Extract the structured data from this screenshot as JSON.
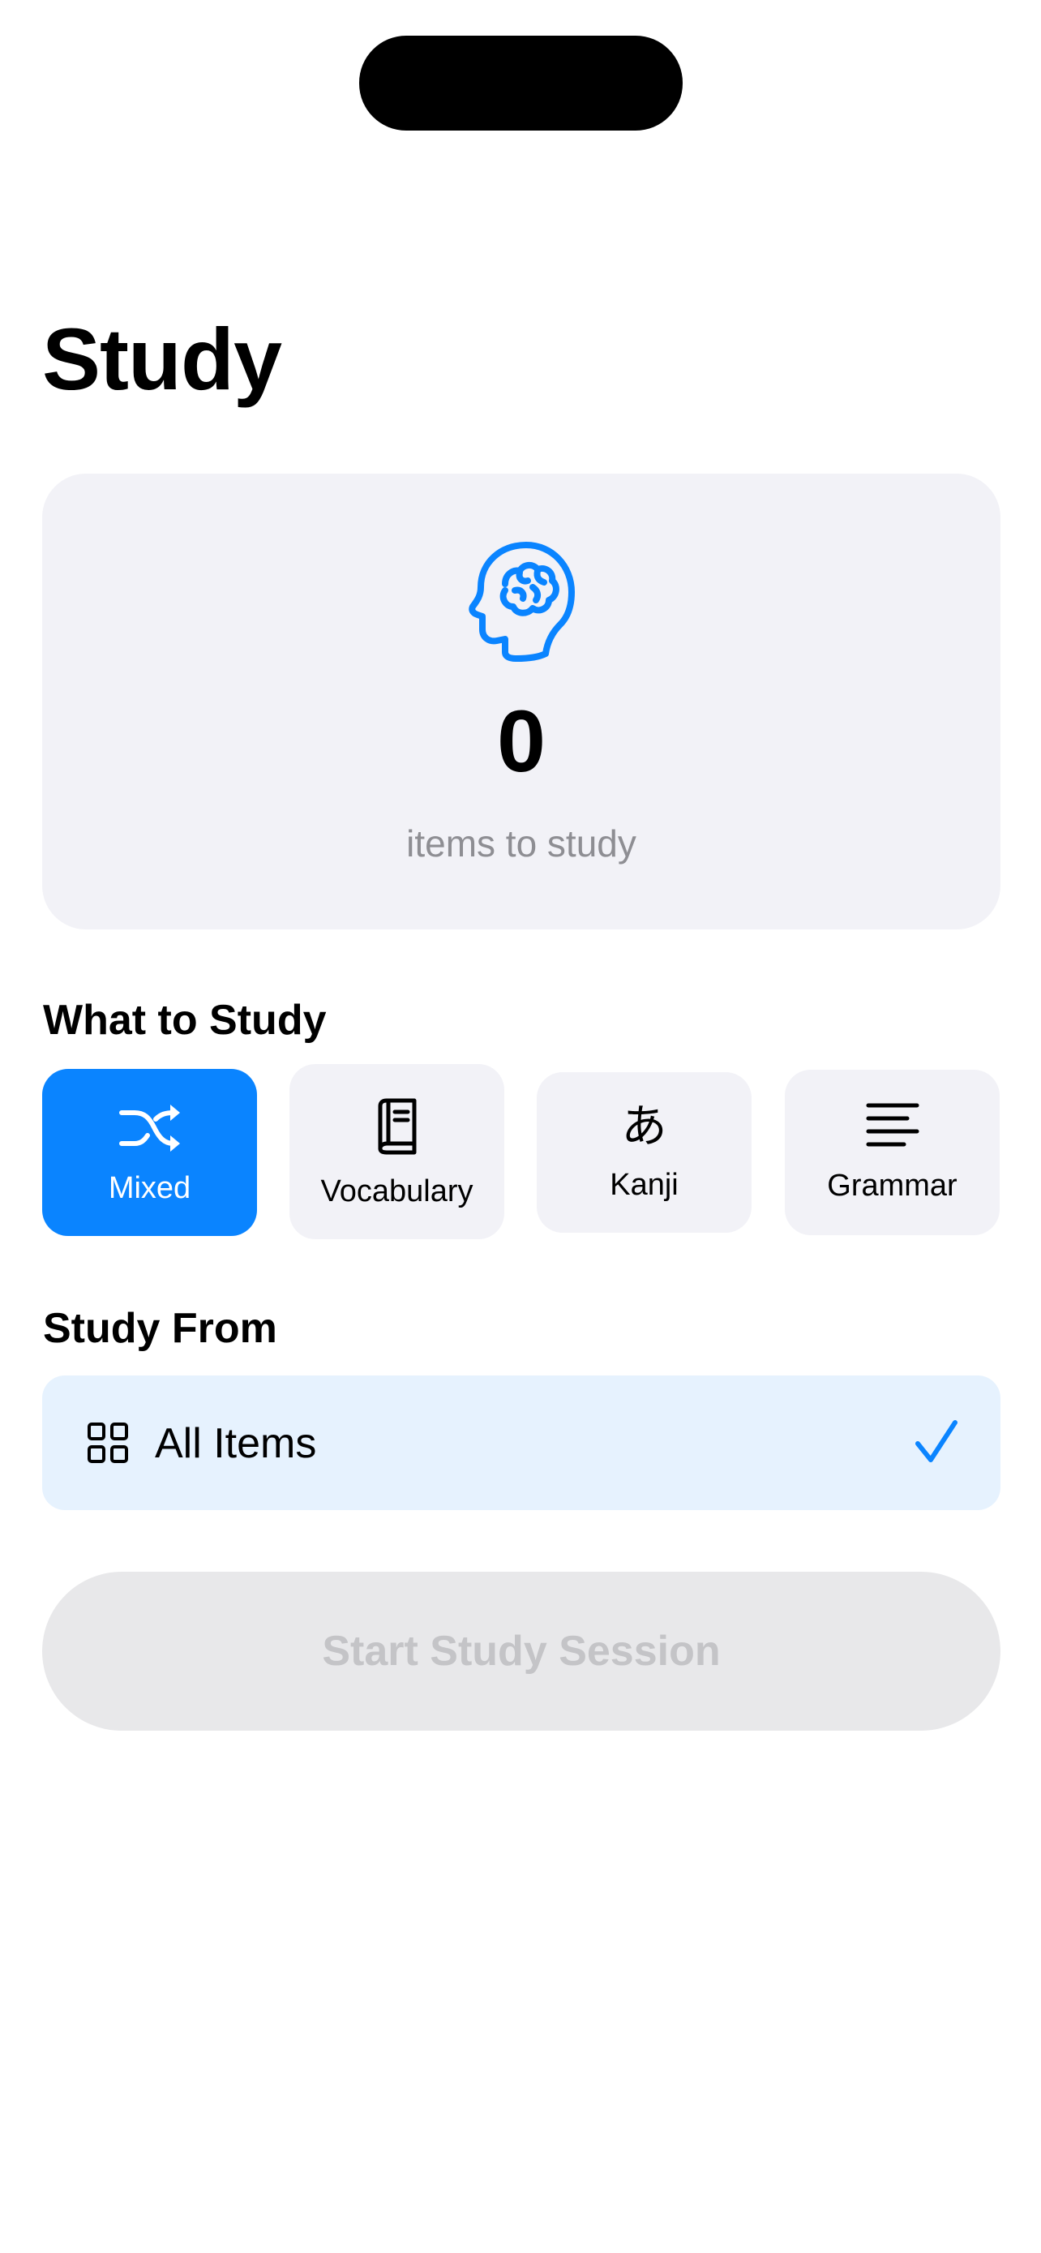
{
  "page": {
    "title": "Study"
  },
  "summary": {
    "icon": "brain-head-icon",
    "count": "0",
    "label": "items to study"
  },
  "what_to_study": {
    "title": "What to Study",
    "options": [
      {
        "label": "Mixed",
        "icon": "shuffle-icon",
        "selected": true
      },
      {
        "label": "Vocabulary",
        "icon": "book-icon",
        "selected": false
      },
      {
        "label": "Kanji",
        "icon": "hiragana-a-icon",
        "glyph": "あ",
        "selected": false
      },
      {
        "label": "Grammar",
        "icon": "text-lines-icon",
        "selected": false
      }
    ]
  },
  "study_from": {
    "title": "Study From",
    "options": [
      {
        "label": "All Items",
        "icon": "grid-icon",
        "selected": true,
        "indicator": "checkmark-icon"
      }
    ]
  },
  "start_button": {
    "label": "Start Study Session",
    "enabled": false
  },
  "colors": {
    "accent": "#0a84ff",
    "card_background": "#f2f2f7",
    "selected_row_background": "#e6f2fe",
    "secondary_text": "#8e8e93",
    "disabled_button": "#e8e8ea",
    "disabled_text": "#c4c4c7"
  }
}
